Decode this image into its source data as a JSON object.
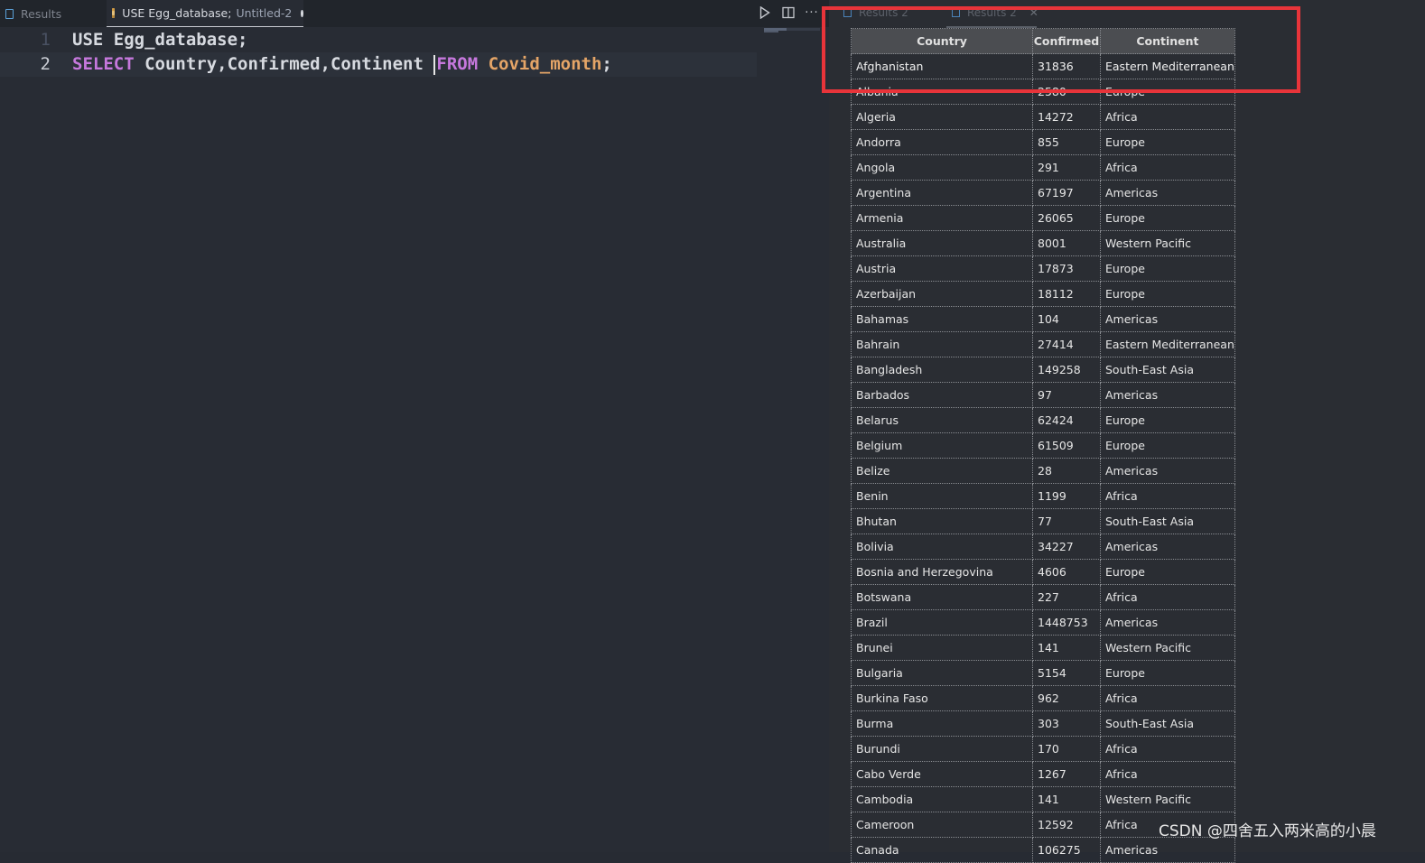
{
  "editor": {
    "tabs": {
      "results_label": "Results",
      "query_label": "USE Egg_database;",
      "query_file": "Untitled-2"
    },
    "lines": [
      {
        "number": "1",
        "tokens": [
          {
            "t": "USE ",
            "c": "kw1"
          },
          {
            "t": "Egg_database;",
            "c": "id"
          }
        ]
      },
      {
        "number": "2",
        "tokens": [
          {
            "t": "SELECT ",
            "c": "kw2"
          },
          {
            "t": "Country,Confirmed,Continent ",
            "c": "id"
          },
          {
            "t": "|",
            "c": "cursor"
          },
          {
            "t": "FROM ",
            "c": "kw2"
          },
          {
            "t": "Covid_month",
            "c": "tbl"
          },
          {
            "t": ";",
            "c": "id"
          }
        ]
      }
    ]
  },
  "results": {
    "tabs": [
      {
        "label": "Results 2"
      },
      {
        "label": "Results 2"
      }
    ],
    "columns": [
      "Country",
      "Confirmed",
      "Continent"
    ],
    "rows": [
      [
        "Afghanistan",
        "31836",
        "Eastern Mediterranean"
      ],
      [
        "Albania",
        "2580",
        "Europe"
      ],
      [
        "Algeria",
        "14272",
        "Africa"
      ],
      [
        "Andorra",
        "855",
        "Europe"
      ],
      [
        "Angola",
        "291",
        "Africa"
      ],
      [
        "Argentina",
        "67197",
        "Americas"
      ],
      [
        "Armenia",
        "26065",
        "Europe"
      ],
      [
        "Australia",
        "8001",
        "Western Pacific"
      ],
      [
        "Austria",
        "17873",
        "Europe"
      ],
      [
        "Azerbaijan",
        "18112",
        "Europe"
      ],
      [
        "Bahamas",
        "104",
        "Americas"
      ],
      [
        "Bahrain",
        "27414",
        "Eastern Mediterranean"
      ],
      [
        "Bangladesh",
        "149258",
        "South-East Asia"
      ],
      [
        "Barbados",
        "97",
        "Americas"
      ],
      [
        "Belarus",
        "62424",
        "Europe"
      ],
      [
        "Belgium",
        "61509",
        "Europe"
      ],
      [
        "Belize",
        "28",
        "Americas"
      ],
      [
        "Benin",
        "1199",
        "Africa"
      ],
      [
        "Bhutan",
        "77",
        "South-East Asia"
      ],
      [
        "Bolivia",
        "34227",
        "Americas"
      ],
      [
        "Bosnia and Herzegovina",
        "4606",
        "Europe"
      ],
      [
        "Botswana",
        "227",
        "Africa"
      ],
      [
        "Brazil",
        "1448753",
        "Americas"
      ],
      [
        "Brunei",
        "141",
        "Western Pacific"
      ],
      [
        "Bulgaria",
        "5154",
        "Europe"
      ],
      [
        "Burkina Faso",
        "962",
        "Africa"
      ],
      [
        "Burma",
        "303",
        "South-East Asia"
      ],
      [
        "Burundi",
        "170",
        "Africa"
      ],
      [
        "Cabo Verde",
        "1267",
        "Africa"
      ],
      [
        "Cambodia",
        "141",
        "Western Pacific"
      ],
      [
        "Cameroon",
        "12592",
        "Africa"
      ],
      [
        "Canada",
        "106275",
        "Americas"
      ]
    ]
  },
  "watermark": "CSDN @四舍五入两米高的小晨",
  "colors": {
    "highlight_box": "#e8343a",
    "keyword": "#c678dd",
    "table_name": "#e5a567"
  },
  "icons": {
    "run": "play-icon",
    "split": "split-editor-icon",
    "more": "more-actions-icon",
    "database": "database-icon",
    "file": "file-icon"
  }
}
